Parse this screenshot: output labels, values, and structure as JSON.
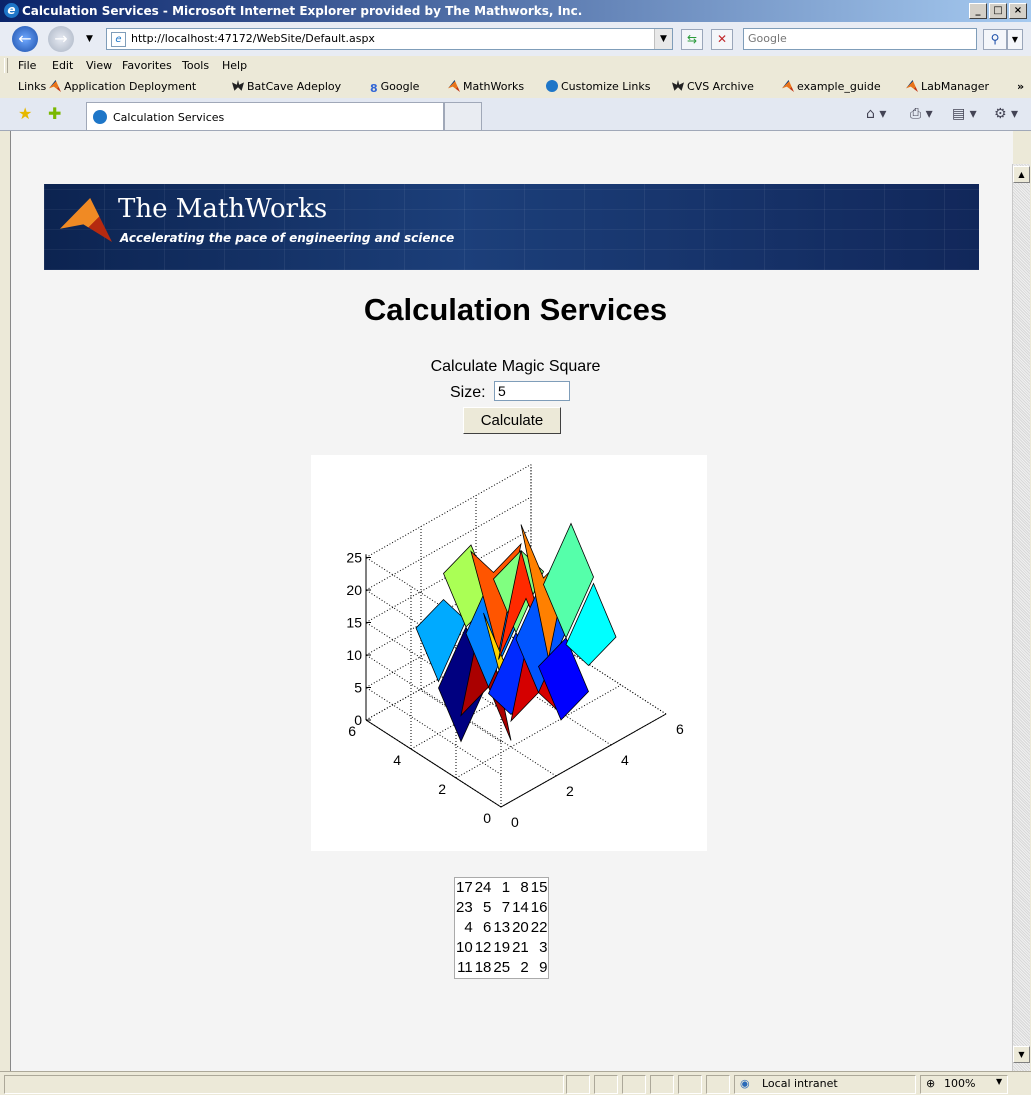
{
  "window": {
    "title": "Calculation Services - Microsoft Internet Explorer provided by The Mathworks, Inc."
  },
  "address": {
    "url": "http://localhost:47172/WebSite/Default.aspx"
  },
  "search": {
    "placeholder": "Google"
  },
  "menu": [
    "File",
    "Edit",
    "View",
    "Favorites",
    "Tools",
    "Help"
  ],
  "links": {
    "label": "Links",
    "items": [
      "Application Deployment",
      "BatCave Adeploy",
      "Google",
      "MathWorks",
      "Customize Links",
      "CVS Archive",
      "example_guide",
      "LabManager"
    ]
  },
  "tab": {
    "title": "Calculation Services"
  },
  "banner": {
    "brand": "The MathWorks",
    "tagline": "Accelerating the pace of engineering and science"
  },
  "page": {
    "heading": "Calculation Services",
    "form_label": "Calculate Magic Square",
    "size_label": "Size:",
    "size_value": "5",
    "button_label": "Calculate"
  },
  "matrix": [
    [
      17,
      24,
      1,
      8,
      15
    ],
    [
      23,
      5,
      7,
      14,
      16
    ],
    [
      4,
      6,
      13,
      20,
      22
    ],
    [
      10,
      12,
      19,
      21,
      3
    ],
    [
      11,
      18,
      25,
      2,
      9
    ]
  ],
  "plot": {
    "z_ticks": [
      "0",
      "5",
      "10",
      "15",
      "20",
      "25"
    ],
    "x_ticks": [
      "0",
      "2",
      "4",
      "6"
    ],
    "y_ticks": [
      "0",
      "2",
      "4",
      "6"
    ]
  },
  "status": {
    "zone": "Local intranet",
    "zoom": "100%"
  },
  "colors": {
    "banner": "#1c3f7a",
    "page_bg": "#f4f4f4"
  }
}
